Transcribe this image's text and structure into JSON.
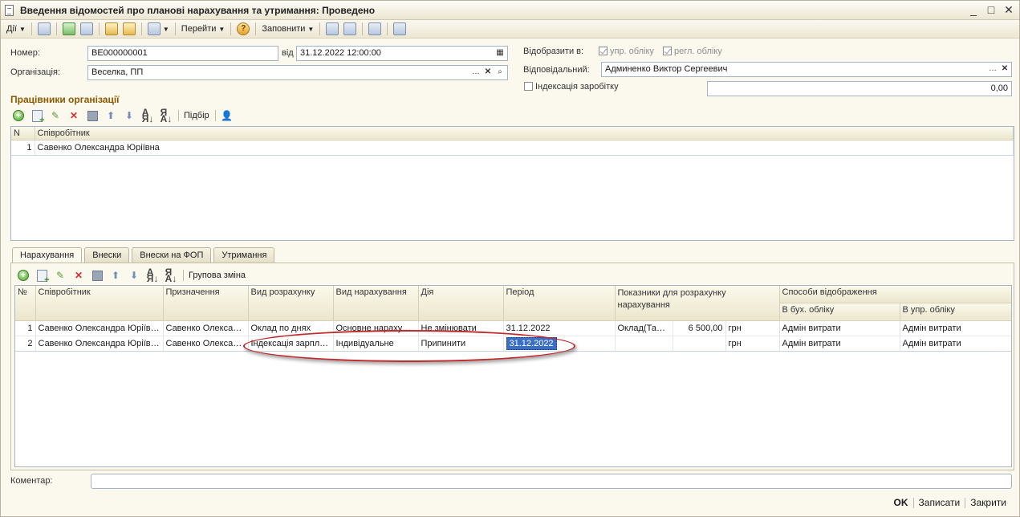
{
  "window": {
    "title": "Введення відомостей про планові нарахування та утримання: Проведено",
    "controls": [
      "_",
      "□",
      "✕"
    ]
  },
  "toolbar": {
    "actions_label": "Дії",
    "goto_label": "Перейти",
    "fill_label": "Заповнити",
    "help_glyph": "?"
  },
  "form": {
    "number_label": "Номер:",
    "number_value": "ВЕ000000001",
    "date_label": "від",
    "date_value": "31.12.2022 12:00:00",
    "org_label": "Організація:",
    "org_value": "Веселка, ПП",
    "show_in_label": "Відобразити в:",
    "mgmt_accounting_label": "упр. обліку",
    "reg_accounting_label": "регл. обліку",
    "responsible_label": "Відповідальний:",
    "responsible_value": "Админенко Виктор Сергеевич",
    "indexation_label": "Індексація заробітку",
    "indexation_value": "0,00",
    "comment_label": "Коментар:",
    "comment_value": ""
  },
  "employees_section": {
    "title": "Працівники організації",
    "select_label": "Підбір",
    "columns": [
      "N",
      "Співробітник"
    ],
    "rows": [
      {
        "n": "1",
        "employee": "Савенко Олександра Юріївна"
      }
    ]
  },
  "tabs": [
    "Нарахування",
    "Внески",
    "Внески на ФОП",
    "Утримання"
  ],
  "accruals": {
    "group_change_label": "Групова зміна",
    "columns": {
      "num": "№",
      "employee": "Співробітник",
      "assignment": "Призначення",
      "calc_type": "Вид розрахунку",
      "accrual_type": "Вид нарахування",
      "action": "Дія",
      "period": "Період",
      "indicators": "Показники для розрахунку нарахування",
      "display": "Способи відображення",
      "display_acc": "В бух. обліку",
      "display_mgmt": "В упр. обліку"
    },
    "rows": [
      {
        "num": "1",
        "employee": "Савенко Олександра Юріївна",
        "assignment": "Савенко Олександра Юріївна",
        "calc_type": "Оклад по днях",
        "accrual_type": "Основне нарахування",
        "action": "Не змінювати",
        "period": "31.12.2022",
        "indicator": "Оклад(Тарифна ставка)",
        "amount": "6 500,00",
        "currency": "грн",
        "display_acc": "Адмін витрати",
        "display_mgmt": "Адмін витрати"
      },
      {
        "num": "2",
        "employee": "Савенко Олександра Юріївна",
        "assignment": "Савенко Олександра Юріївна",
        "calc_type": "Індексація зарплати",
        "accrual_type": "Індивідуальне",
        "action": "Припинити",
        "period": "31.12.2022",
        "indicator": "",
        "amount": "",
        "currency": "грн",
        "display_acc": "Адмін витрати",
        "display_mgmt": "Адмін витрати"
      }
    ]
  },
  "footer": {
    "ok": "OK",
    "save": "Записати",
    "close": "Закрити"
  },
  "colors": {
    "section_title": "#8b5a00",
    "selection": "#3a6fc4",
    "annotation_oval": "#c02a2a"
  }
}
